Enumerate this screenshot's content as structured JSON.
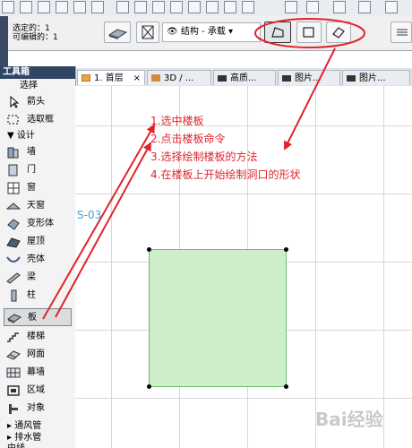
{
  "selection_info": {
    "selected": "选定的：1",
    "editable": "可编辑的：1"
  },
  "structure_dropdown": "结构 - 承载",
  "tabs": [
    {
      "label": "1. 首层",
      "close": "×"
    },
    {
      "label": "3D / ...",
      "close": ""
    },
    {
      "label": "高质...",
      "close": ""
    },
    {
      "label": "图片...",
      "close": ""
    },
    {
      "label": "图片...",
      "close": ""
    }
  ],
  "toolbox": {
    "title": "工具箱",
    "select_header": "选择",
    "items_select": [
      {
        "label": "箭头"
      },
      {
        "label": "选取框"
      }
    ],
    "design_header": "▼ 设计",
    "items_design": [
      {
        "label": "墙"
      },
      {
        "label": "门"
      },
      {
        "label": "窗"
      },
      {
        "label": "天窗"
      },
      {
        "label": "变形体"
      },
      {
        "label": "屋顶"
      },
      {
        "label": "壳体"
      },
      {
        "label": "梁"
      },
      {
        "label": "柱"
      },
      {
        "label": "板"
      },
      {
        "label": "楼梯"
      },
      {
        "label": "网面"
      },
      {
        "label": "幕墙"
      },
      {
        "label": "区域"
      },
      {
        "label": "对象"
      }
    ],
    "sub_sections": [
      "▸ 通风管",
      "▸ 排水管",
      "中线"
    ]
  },
  "annotations": [
    "1.选中楼板",
    "2.点击楼板命令",
    "3.选择绘制楼板的方法",
    "4.在楼板上开始绘制洞口的形状"
  ],
  "canvas_label": "S-03",
  "watermark": "Bai经验",
  "colors": {
    "annotation": "#e0242c",
    "slab_fill": "#cdeec8",
    "slab_border": "#6cc06a",
    "toolbox_header": "#2f4564"
  }
}
